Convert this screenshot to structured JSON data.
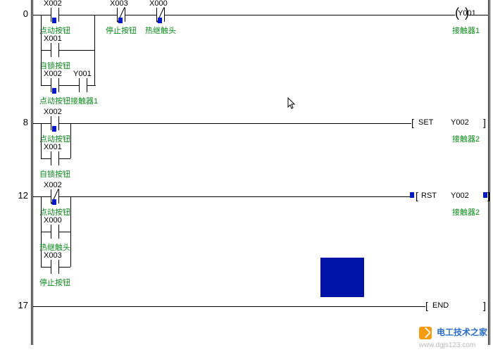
{
  "chart_data": {
    "type": "ladder-diagram",
    "rungs": [
      {
        "num": 0,
        "branches": [
          {
            "elems": [
              {
                "t": "NO",
                "addr": "X002",
                "label": "点动按钮",
                "tick": true
              },
              {
                "t": "NC",
                "addr": "X003",
                "label": "停止按钮",
                "tick": true
              },
              {
                "t": "NC",
                "addr": "X000",
                "label": "热继触头",
                "tick": true
              }
            ],
            "out": {
              "t": "COIL",
              "addr": "Y001",
              "label": "接触器1"
            }
          },
          {
            "elems": [
              {
                "t": "NO",
                "addr": "X001",
                "label": "自锁按钮"
              }
            ]
          },
          {
            "elems": [
              {
                "t": "NO",
                "addr": "X002",
                "label": "点动按钮",
                "tick": true
              },
              {
                "t": "NO",
                "addr": "Y001",
                "label": "接触器1"
              }
            ]
          }
        ]
      },
      {
        "num": 8,
        "branches": [
          {
            "elems": [
              {
                "t": "NO",
                "addr": "X002",
                "label": "点动按钮",
                "tick": true
              }
            ],
            "out": {
              "t": "SET",
              "addr": "Y002",
              "label": "接触器2"
            }
          },
          {
            "elems": [
              {
                "t": "NO",
                "addr": "X001",
                "label": "自锁按钮"
              }
            ]
          }
        ]
      },
      {
        "num": 12,
        "branches": [
          {
            "elems": [
              {
                "t": "NC",
                "addr": "X002",
                "label": "点动按钮",
                "tick": true
              }
            ],
            "out": {
              "t": "RST",
              "addr": "Y002",
              "label": "接触器2",
              "tick": true
            }
          },
          {
            "elems": [
              {
                "t": "NO",
                "addr": "X000",
                "label": "热继触头"
              }
            ]
          },
          {
            "elems": [
              {
                "t": "NO",
                "addr": "X003",
                "label": "停止按钮"
              }
            ]
          }
        ]
      },
      {
        "num": 17,
        "out": {
          "t": "END"
        }
      }
    ]
  },
  "rung0": {
    "num": "0"
  },
  "rung8": {
    "num": "8"
  },
  "rung12": {
    "num": "12"
  },
  "rung17": {
    "num": "17"
  },
  "addrs": {
    "x000": "X000",
    "x001": "X001",
    "x002": "X002",
    "x003": "X003",
    "y001": "Y001",
    "y002": "Y002"
  },
  "labels": {
    "jog": "点动按钮",
    "stop": "停止按钮",
    "thermal": "热继触头",
    "latch": "自锁按钮",
    "contactor1": "接触器1",
    "contactor2": "接触器2"
  },
  "funcs": {
    "set": "SET",
    "rst": "RST",
    "end": "END"
  },
  "watermark": {
    "brand": "电工技术之家",
    "url": "www.dgjs123.com"
  }
}
